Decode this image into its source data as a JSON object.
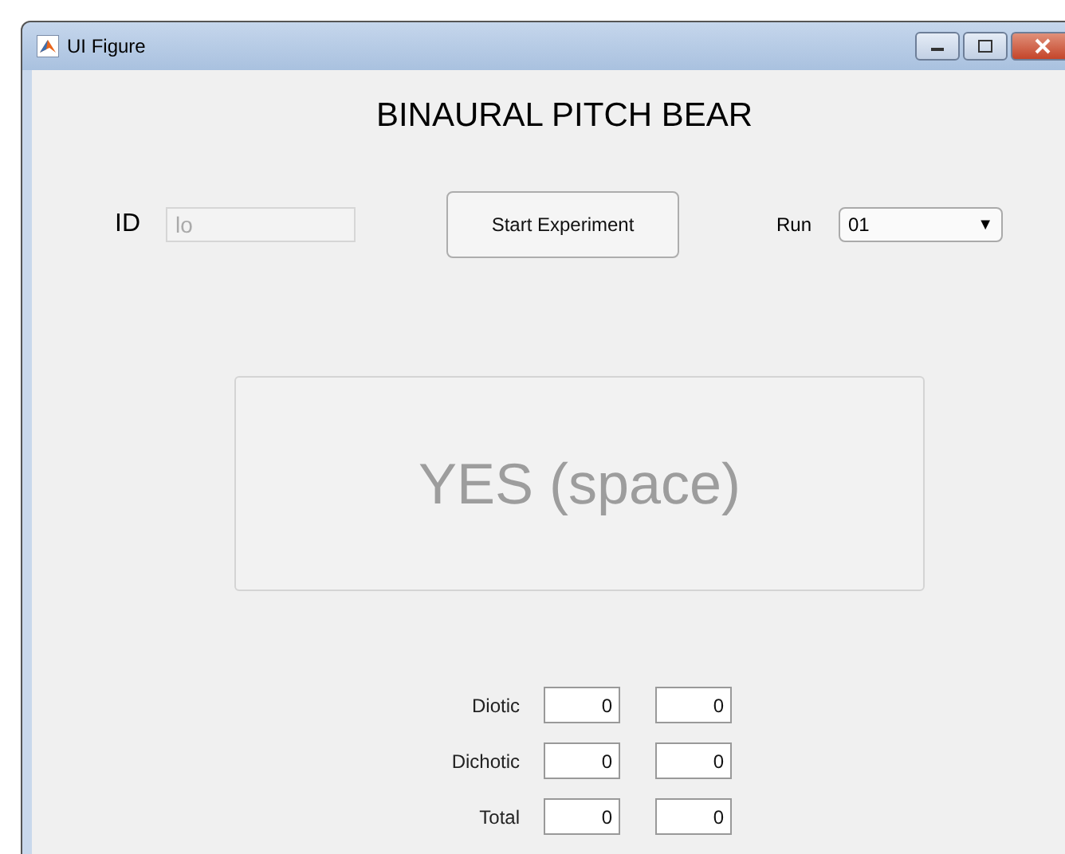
{
  "window": {
    "title": "UI Figure"
  },
  "heading": "BINAURAL PITCH BEAR",
  "id_field": {
    "label": "ID",
    "value": "lo",
    "disabled": true
  },
  "start_button": "Start Experiment",
  "run": {
    "label": "Run",
    "value": "01",
    "arrow": "▼"
  },
  "response_panel": {
    "text": "YES (space)",
    "disabled": true
  },
  "scores": [
    {
      "label": "Diotic",
      "values": [
        "0",
        "0"
      ]
    },
    {
      "label": "Dichotic",
      "values": [
        "0",
        "0"
      ]
    },
    {
      "label": "Total",
      "values": [
        "0",
        "0"
      ]
    }
  ]
}
